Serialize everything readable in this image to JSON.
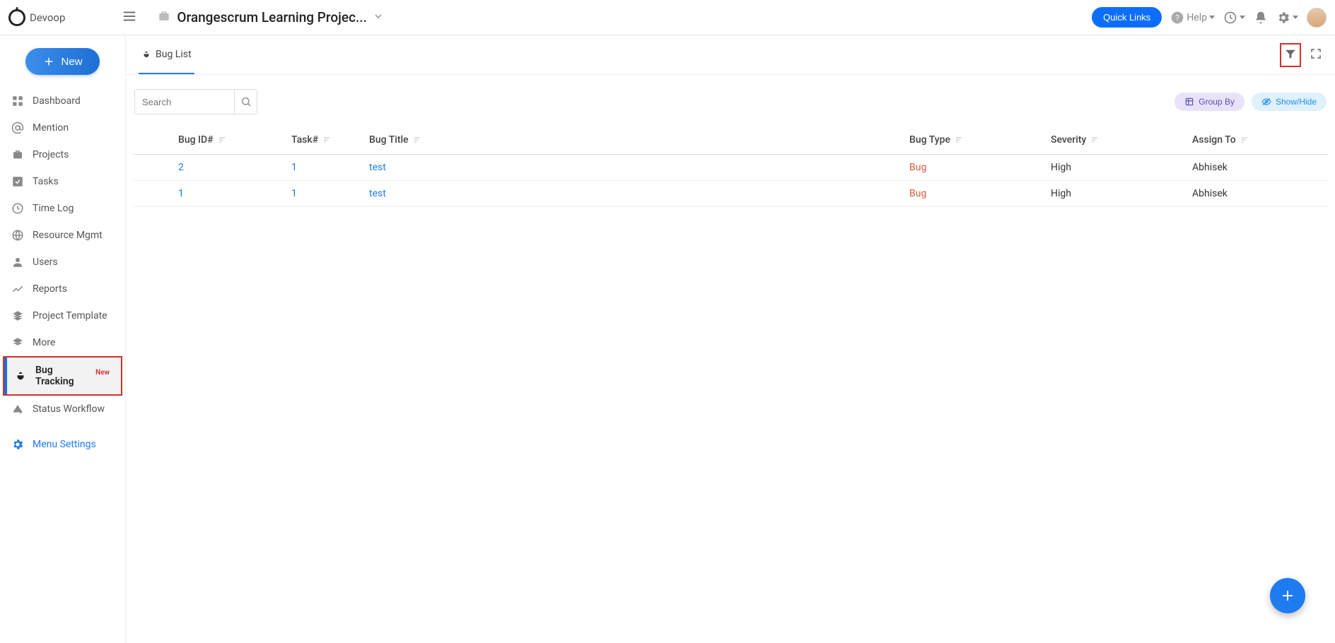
{
  "brand": "Devoop",
  "project_name": "Orangescrum Learning Projec...",
  "quick_links_label": "Quick Links",
  "help_label": "Help",
  "new_button_label": "New",
  "sidebar": {
    "items": [
      {
        "label": "Dashboard"
      },
      {
        "label": "Mention"
      },
      {
        "label": "Projects"
      },
      {
        "label": "Tasks"
      },
      {
        "label": "Time Log"
      },
      {
        "label": "Resource Mgmt"
      },
      {
        "label": "Users"
      },
      {
        "label": "Reports"
      },
      {
        "label": "Project Template"
      },
      {
        "label": "More"
      },
      {
        "label": "Bug Tracking",
        "badge": "New"
      },
      {
        "label": "Status Workflow"
      },
      {
        "label": "Menu Settings"
      }
    ]
  },
  "tab_label": "Bug List",
  "search_placeholder": "Search",
  "group_by_label": "Group By",
  "show_hide_label": "Show/Hide",
  "table": {
    "columns": [
      "Bug ID#",
      "Task#",
      "Bug Title",
      "Bug Type",
      "Severity",
      "Assign To"
    ],
    "rows": [
      {
        "bug_id": "2",
        "task": "1",
        "title": "test",
        "type": "Bug",
        "severity": "High",
        "assign": "Abhisek"
      },
      {
        "bug_id": "1",
        "task": "1",
        "title": "test",
        "type": "Bug",
        "severity": "High",
        "assign": "Abhisek"
      }
    ]
  }
}
